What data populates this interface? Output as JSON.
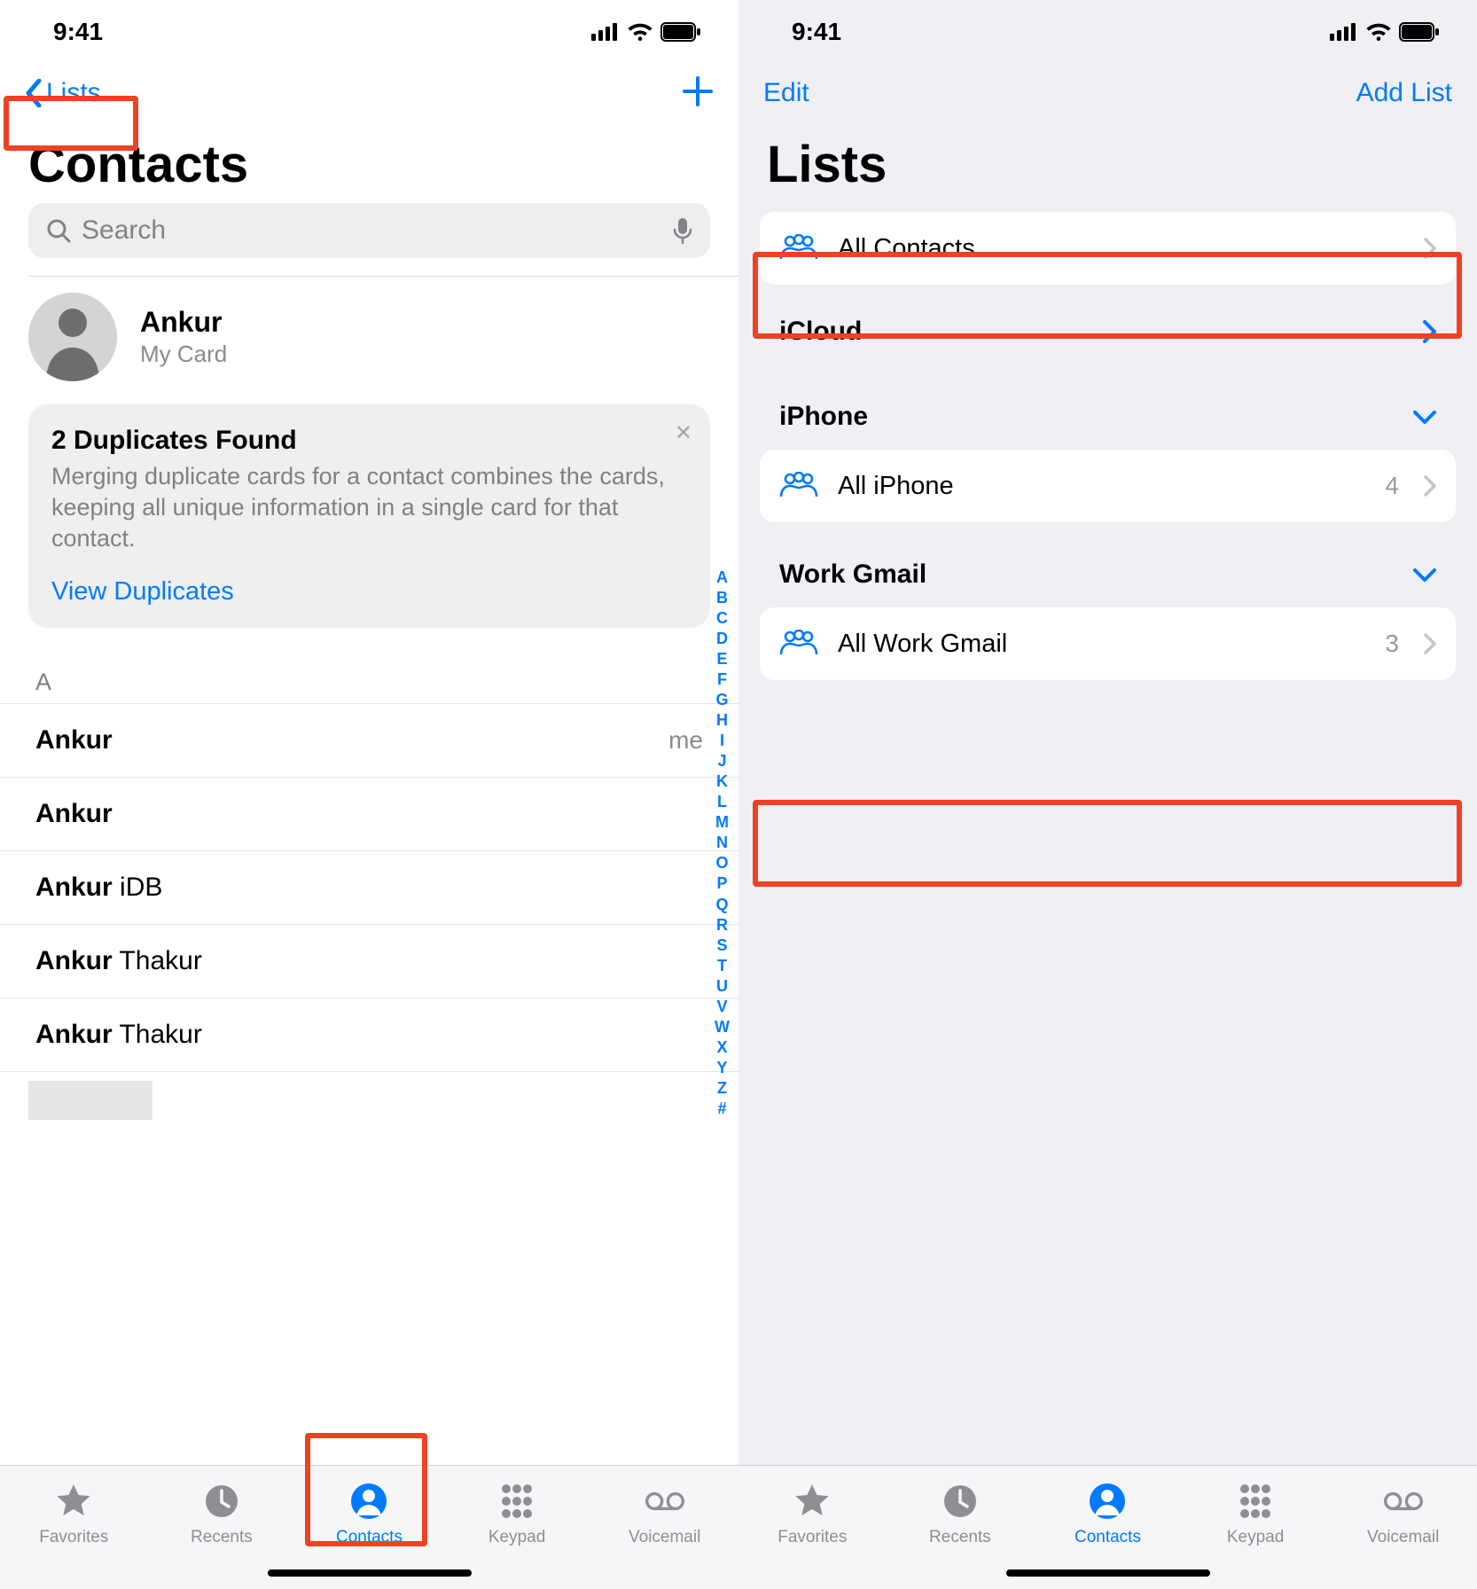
{
  "status": {
    "time": "9:41"
  },
  "left": {
    "nav_back_label": "Lists",
    "title": "Contacts",
    "search_placeholder": "Search",
    "mycard": {
      "name": "Ankur",
      "sub": "My Card"
    },
    "duplicates": {
      "title": "2 Duplicates Found",
      "body": "Merging duplicate cards for a contact combines the cards, keeping all unique information in a single card for that contact.",
      "link": "View Duplicates"
    },
    "section_letter": "A",
    "rows": [
      {
        "first": "Ankur",
        "last": "",
        "tag": "me"
      },
      {
        "first": "Ankur",
        "last": ""
      },
      {
        "first": "Ankur",
        "last": "iDB"
      },
      {
        "first": "Ankur",
        "last": "Thakur"
      },
      {
        "first": "Ankur",
        "last": "Thakur"
      }
    ],
    "index_letters": [
      "A",
      "B",
      "C",
      "D",
      "E",
      "F",
      "G",
      "H",
      "I",
      "J",
      "K",
      "L",
      "M",
      "N",
      "O",
      "P",
      "Q",
      "R",
      "S",
      "T",
      "U",
      "V",
      "W",
      "X",
      "Y",
      "Z",
      "#"
    ]
  },
  "right": {
    "nav_left": "Edit",
    "nav_right": "Add List",
    "title": "Lists",
    "rows": {
      "all_contacts": "All Contacts",
      "icloud_header": "iCloud",
      "iphone_header": "iPhone",
      "all_iphone": {
        "label": "All iPhone",
        "count": "4"
      },
      "gmail_header": "Work Gmail",
      "all_gmail": {
        "label": "All Work Gmail",
        "count": "3"
      }
    }
  },
  "tabs": {
    "favorites": "Favorites",
    "recents": "Recents",
    "contacts": "Contacts",
    "keypad": "Keypad",
    "voicemail": "Voicemail"
  }
}
